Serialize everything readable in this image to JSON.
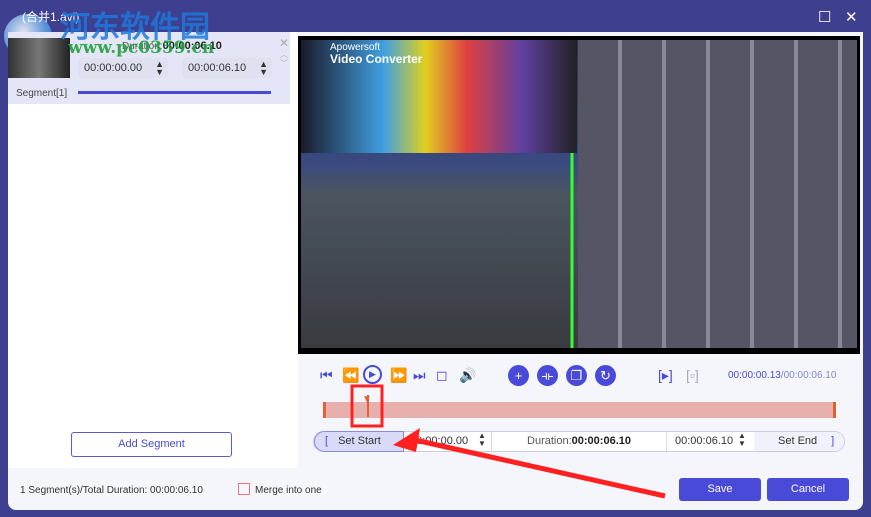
{
  "window": {
    "title": "(合并1.avi)",
    "maximize_icon": "maximize-icon",
    "close_icon": "close-icon"
  },
  "watermark": {
    "text": "河东软件园",
    "url": "www.pc0359.cn"
  },
  "segment": {
    "duration_label": "Duration:",
    "duration": "00:00:06.10",
    "start": "00:00:00.00",
    "end": "00:00:06.10",
    "label": "Segment[1]"
  },
  "left": {
    "add_segment": "Add Segment"
  },
  "video": {
    "brand": "Apowersoft",
    "product": "Video Converter"
  },
  "player": {
    "current": "00:00:00.13",
    "total": "/00:00:06.10",
    "progress": 0.02
  },
  "trim": {
    "set_start": "Set Start",
    "start": "00:00:00.00",
    "duration_label": "Duration:",
    "duration": "00:00:06.10",
    "end": "00:00:06.10",
    "set_end": "Set End"
  },
  "footer": {
    "summary": "1 Segment(s)/Total Duration: 00:00:06.10",
    "merge_label": "Merge into one",
    "merge_checked": false,
    "save": "Save",
    "cancel": "Cancel"
  },
  "colors": {
    "accent": "#4a4ad8",
    "frame": "#3f3f8f",
    "annotation": "#ff2020"
  }
}
